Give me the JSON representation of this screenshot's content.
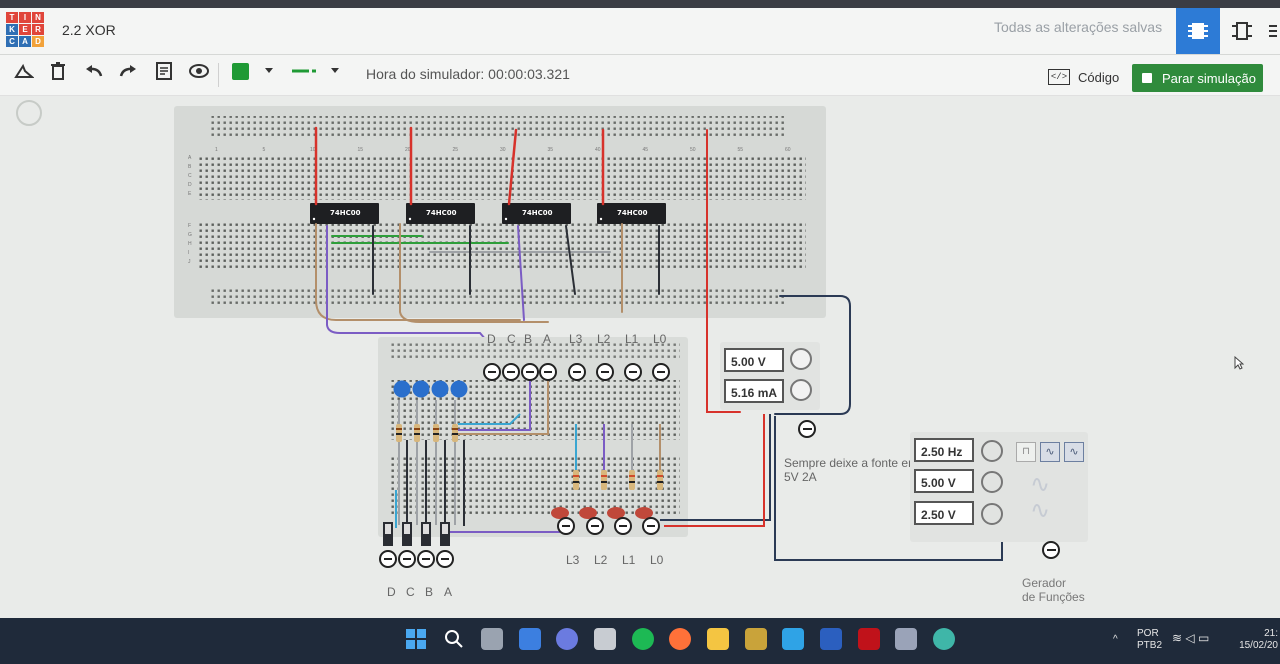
{
  "app": {
    "project_title": "2.2 XOR",
    "saved_status": "Todas as alterações salvas"
  },
  "logo": {
    "letters": [
      "T",
      "I",
      "N",
      "K",
      "E",
      "R",
      "C",
      "A",
      "D"
    ]
  },
  "toolbar": {
    "sim_time_label": "Hora do simulador: 00:00:03.321",
    "code_label": "Código",
    "stop_label": "Parar simulação",
    "wire_color": "#1f9a35"
  },
  "breadboard_top": {
    "column_numbers": [
      "1",
      "5",
      "10",
      "15",
      "20",
      "25",
      "30",
      "35",
      "40",
      "45",
      "50",
      "55",
      "60"
    ],
    "row_letters": [
      "A",
      "B",
      "C",
      "D",
      "E",
      "F",
      "G",
      "H",
      "I",
      "J"
    ],
    "chips": [
      {
        "label": "74HC00"
      },
      {
        "label": "74HC00"
      },
      {
        "label": "74HC00"
      },
      {
        "label": "74HC00"
      }
    ]
  },
  "inputs": {
    "top_labels": [
      "D",
      "C",
      "B",
      "A"
    ],
    "bottom_labels": [
      "D",
      "C",
      "B",
      "A"
    ]
  },
  "outputs": {
    "top_labels": [
      "L3",
      "L2",
      "L1",
      "L0"
    ],
    "bottom_labels": [
      "L3",
      "L2",
      "L1",
      "L0"
    ]
  },
  "power_supply": {
    "voltage": "5.00 V",
    "current": "5.16 mA"
  },
  "note": "Sempre deixe a fonte em 5V 2A",
  "function_generator": {
    "frequency": "2.50 Hz",
    "amplitude": "5.00 V",
    "offset": "2.50 V",
    "label_line1": "Gerador",
    "label_line2": "de Funções"
  },
  "taskbar": {
    "lang": "POR",
    "layout": "PTB2",
    "time": "21:",
    "date": "15/02/20"
  }
}
